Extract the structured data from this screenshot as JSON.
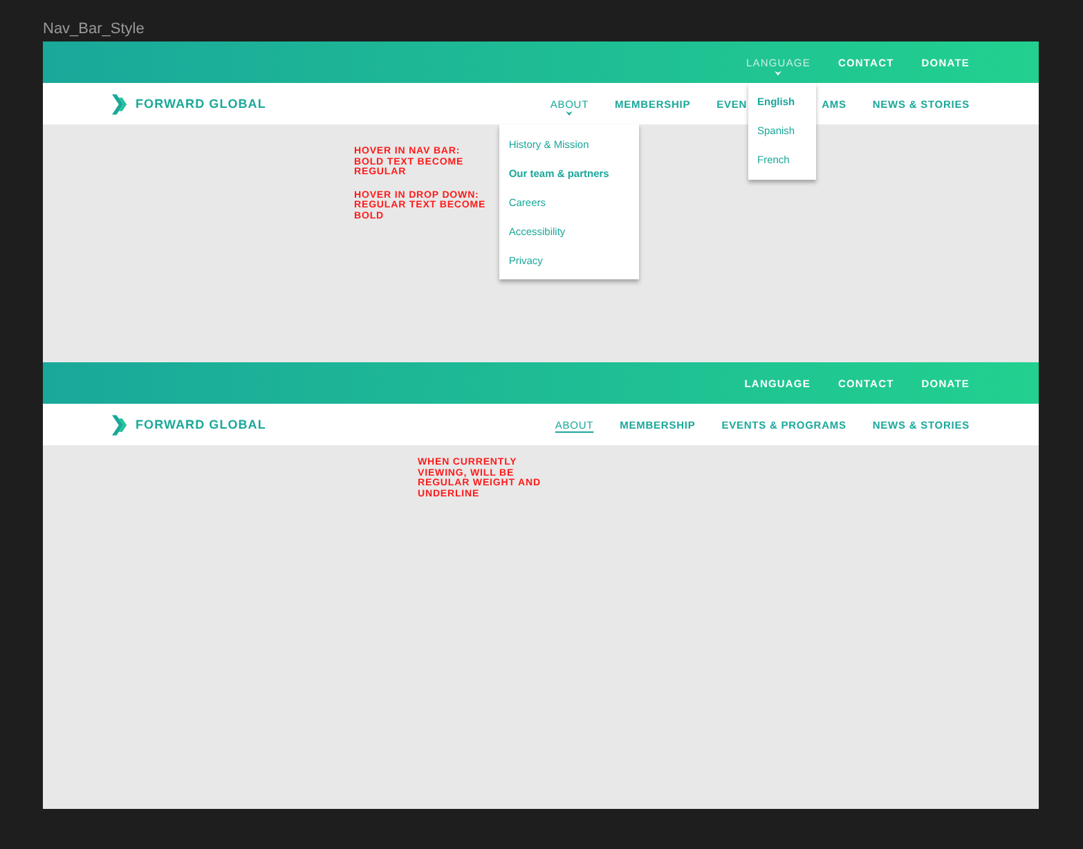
{
  "canvas_label": "Nav_Bar_Style",
  "frames": [
    {
      "top_links": [
        {
          "label": "LANGUAGE",
          "hovered": true,
          "menu": [
            {
              "label": "English",
              "hovered": true
            },
            {
              "label": "Spanish",
              "hovered": false
            },
            {
              "label": "French",
              "hovered": false
            }
          ]
        },
        {
          "label": "CONTACT",
          "hovered": false
        },
        {
          "label": "DONATE",
          "hovered": false
        }
      ],
      "brand": "FORWARD GLOBAL",
      "nav": [
        {
          "label": "ABOUT",
          "hovered": true,
          "current": false,
          "menu": [
            {
              "label": "History & Mission",
              "hovered": false
            },
            {
              "label": "Our team & partners",
              "hovered": true
            },
            {
              "label": "Careers",
              "hovered": false
            },
            {
              "label": "Accessibility",
              "hovered": false
            },
            {
              "label": "Privacy",
              "hovered": false
            }
          ]
        },
        {
          "label": "MEMBERSHIP",
          "hovered": false,
          "current": false
        },
        {
          "label_parts": [
            "EVEN",
            "AMS"
          ],
          "hovered": false,
          "current": false
        },
        {
          "label": "NEWS & STORIES",
          "hovered": false,
          "current": false
        }
      ],
      "notes": [
        "HOVER IN NAV BAR: BOLD TEXT BECOME REGULAR",
        "HOVER IN DROP DOWN: REGULAR TEXT BECOME BOLD"
      ]
    },
    {
      "top_links": [
        {
          "label": "LANGUAGE",
          "hovered": false
        },
        {
          "label": "CONTACT",
          "hovered": false
        },
        {
          "label": "DONATE",
          "hovered": false
        }
      ],
      "brand": "FORWARD GLOBAL",
      "nav": [
        {
          "label": "ABOUT",
          "hovered": false,
          "current": true
        },
        {
          "label": "MEMBERSHIP",
          "hovered": false,
          "current": false
        },
        {
          "label": "EVENTS & PROGRAMS",
          "hovered": false,
          "current": false
        },
        {
          "label": "NEWS & STORIES",
          "hovered": false,
          "current": false
        }
      ],
      "notes": [
        "WHEN CURRENTLY VIEWING, WILL BE REGULAR WEIGHT AND UNDERLINE"
      ]
    }
  ]
}
